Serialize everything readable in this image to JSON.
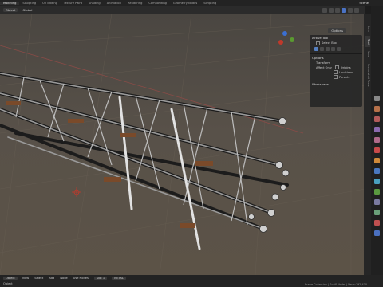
{
  "topbar": {
    "tabs": [
      "Modeling",
      "Sculpting",
      "UV Editing",
      "Texture Paint",
      "Shading",
      "Animation",
      "Rendering",
      "Compositing",
      "Geometry Nodes",
      "Scripting"
    ],
    "scene": "Scene"
  },
  "header": {
    "mode": "Object",
    "orientation": "Global",
    "options_label": "Options"
  },
  "npanel": {
    "active_tool": "Active Tool",
    "select_box": "Select Box",
    "options": "Options",
    "transform": "Transform",
    "affect_only": "Affect Only",
    "origins": "Origins",
    "locations": "Locations",
    "parents": "Parents",
    "workspace": "Workspace"
  },
  "vtabs": [
    "Item",
    "Tool",
    "View",
    "Screenshot Tools"
  ],
  "statusbar": {
    "object_label": "Object",
    "view": "View",
    "select": "Select",
    "add": "Add",
    "node": "Node",
    "use_nodes": "Use Nodes",
    "slot": "Slot 1",
    "material": "METAL",
    "bottom_object": "Object",
    "info": "Scene Collection | Scaff Model | Verts:192,470"
  }
}
